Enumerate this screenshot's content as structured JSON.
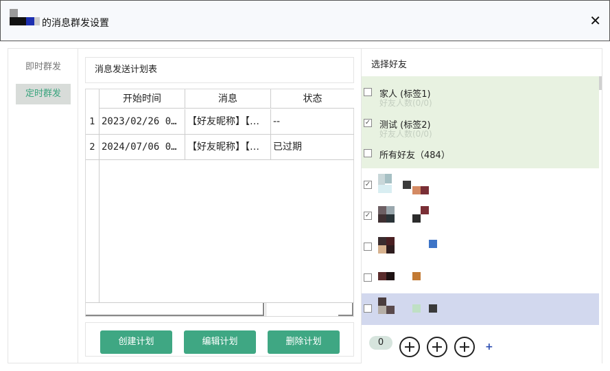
{
  "window": {
    "title_prefix": "的消息群发设置",
    "close_glyph": "✕"
  },
  "nav": {
    "items": [
      {
        "label": "即时群发"
      },
      {
        "label": "定时群发"
      }
    ]
  },
  "plan": {
    "header": "消息发送计划表",
    "columns": [
      "开始时间",
      "消息",
      "状态"
    ],
    "rows": [
      {
        "num": "1",
        "start": "2023/02/26 0…",
        "message": "【好友昵称】【…",
        "status": "--"
      },
      {
        "num": "2",
        "start": "2024/07/06 0…",
        "message": "【好友昵称】【…",
        "status": "已过期"
      }
    ],
    "buttons": {
      "create": "创建计划",
      "edit": "编辑计划",
      "delete": "删除计划"
    }
  },
  "friends": {
    "title": "选择好友",
    "tags": [
      {
        "name": "家人 (标签1)",
        "count": "好友人数(0/0)",
        "checked": false
      },
      {
        "name": "测试 (标签2)",
        "count": "好友人数(0/0)",
        "checked": true
      },
      {
        "name": "所有好友（484）",
        "count": "",
        "checked": false
      }
    ],
    "contacts": [
      {
        "checked": true
      },
      {
        "checked": true
      },
      {
        "checked": false
      },
      {
        "checked": false
      },
      {
        "checked": false,
        "selected": true
      }
    ],
    "selected_count": "0",
    "check_glyph": "✓",
    "plus_glyph": "+"
  },
  "colors": {
    "accent": "#3fa783",
    "tag_bg": "#e8f2e1",
    "selected_bg": "#d2d8ee"
  }
}
